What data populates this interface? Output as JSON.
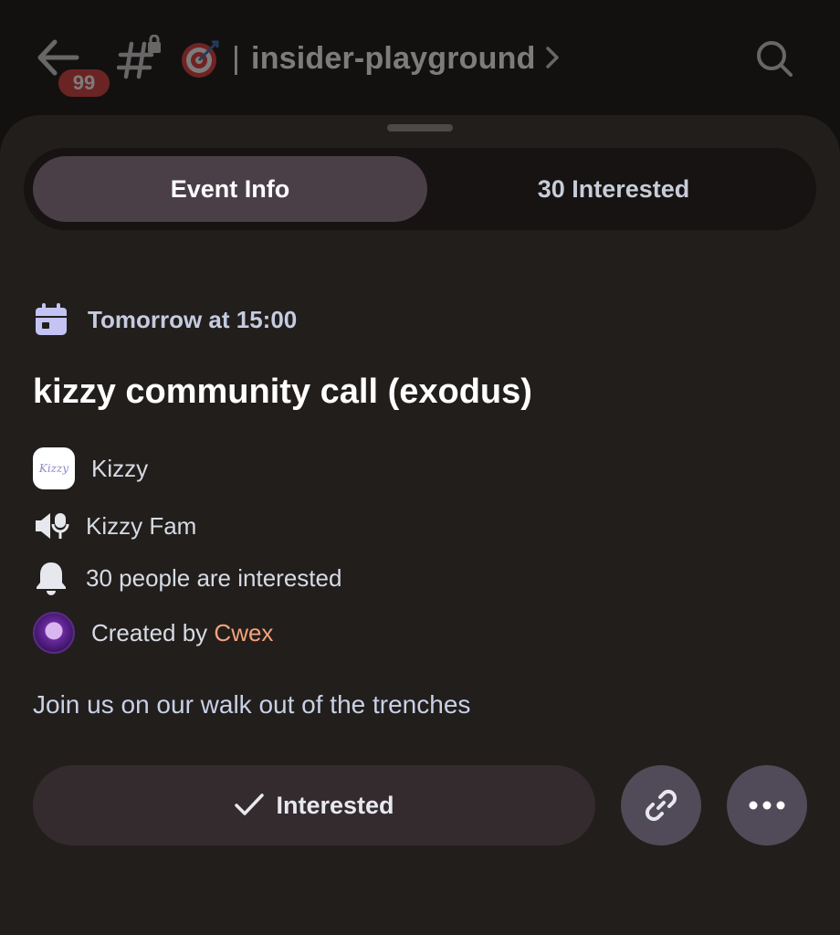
{
  "header": {
    "unread_count": "99",
    "separator": "|",
    "channel_name": "insider-playground",
    "icons": [
      "back-arrow-icon",
      "locked-hash-icon",
      "target-emoji-icon",
      "chevron-right-icon",
      "search-icon"
    ]
  },
  "tabs": [
    {
      "label": "Event Info",
      "active": true
    },
    {
      "label": "30 Interested",
      "active": false
    }
  ],
  "event": {
    "time": "Tomorrow at 15:00",
    "title": "kizzy community call (exodus)",
    "guild_name": "Kizzy",
    "guild_logo_text": "Kizzy",
    "channel_name": "Kizzy Fam",
    "interest_text": "30 people are interested",
    "created_by_prefix": "Created by",
    "creator_name": "Cwex",
    "description": "Join us on our walk out of the trenches"
  },
  "actions": {
    "interested_label": "Interested",
    "icons": [
      "checkmark-icon",
      "link-icon",
      "more-icon"
    ]
  },
  "colors": {
    "sheet_bg": "#221e1c",
    "active_tab": "#4a3f47",
    "accent_creator": "#f4a37a",
    "calendar_icon": "#c3c4f4",
    "badge_red": "#d83c3e"
  }
}
